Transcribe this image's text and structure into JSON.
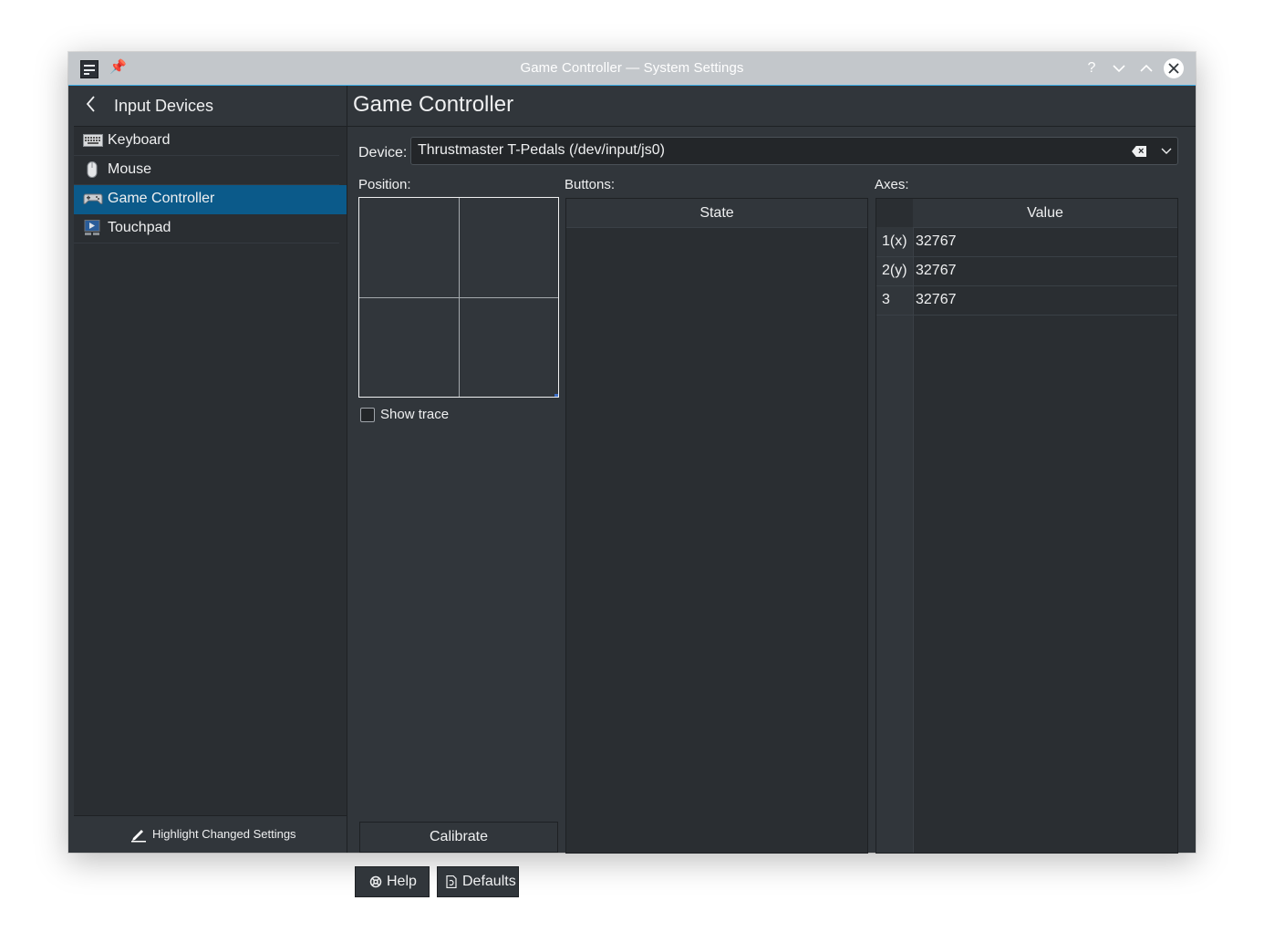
{
  "window": {
    "title": "Game Controller — System Settings",
    "icons": {
      "app": "system-settings-icon",
      "pin": "pin-icon",
      "help": "?",
      "minimize": "chevron-down-icon",
      "maximize": "chevron-up-icon",
      "close": "close-icon"
    }
  },
  "sidebar": {
    "header": "Input Devices",
    "items": [
      {
        "label": "Keyboard",
        "icon": "keyboard-icon"
      },
      {
        "label": "Mouse",
        "icon": "mouse-icon"
      },
      {
        "label": "Game Controller",
        "icon": "gamepad-icon",
        "selected": true
      },
      {
        "label": "Touchpad",
        "icon": "touchpad-icon"
      }
    ],
    "footer": "Highlight Changed Settings"
  },
  "main": {
    "title": "Game Controller",
    "device_label": "Device:",
    "device_value": "Thrustmaster T-Pedals (/dev/input/js0)",
    "position_label": "Position:",
    "buttons_label": "Buttons:",
    "axes_label": "Axes:",
    "show_trace_label": "Show trace",
    "calibrate_label": "Calibrate",
    "buttons_table": {
      "header": "State"
    },
    "axes_table": {
      "header": "Value",
      "rows": [
        {
          "axis": "1(x)",
          "value": "32767"
        },
        {
          "axis": "2(y)",
          "value": "32767"
        },
        {
          "axis": "3",
          "value": "32767"
        }
      ]
    },
    "help_label": "Help",
    "defaults_label": "Defaults"
  },
  "colors": {
    "accent": "#3daee9",
    "selection": "#0b5a8a",
    "background": "#31363b",
    "titlebar": "#c3c7cb"
  }
}
